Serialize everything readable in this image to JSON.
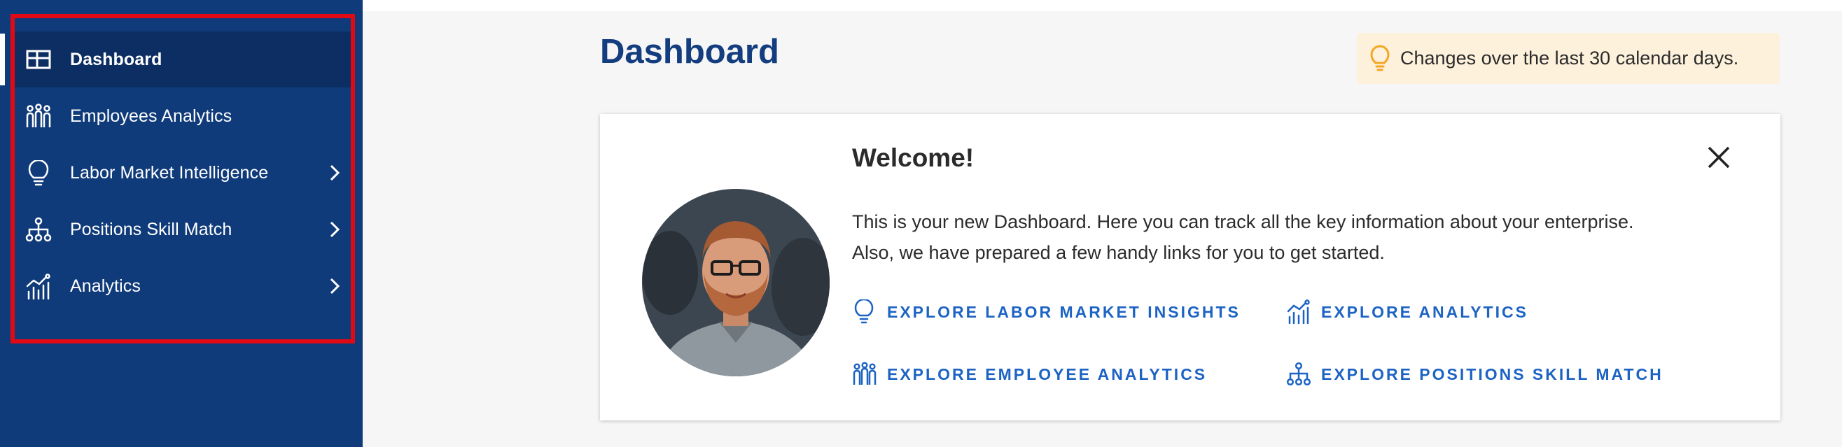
{
  "sidebar": {
    "items": [
      {
        "label": "Dashboard",
        "icon": "dashboard-grid-icon",
        "active": true
      },
      {
        "label": "Employees Analytics",
        "icon": "people-group-icon"
      },
      {
        "label": "Labor Market Intelligence",
        "icon": "lightbulb-icon",
        "has_submenu": true
      },
      {
        "label": "Positions Skill Match",
        "icon": "hierarchy-icon",
        "has_submenu": true
      },
      {
        "label": "Analytics",
        "icon": "trend-chart-icon",
        "has_submenu": true
      }
    ]
  },
  "main": {
    "title": "Dashboard",
    "notice": {
      "icon": "lightbulb-icon",
      "text": "Changes over the last 30 calendar days."
    },
    "welcome_card": {
      "title": "Welcome!",
      "line1": "This is your new Dashboard. Here you can track all the key information about your enterprise.",
      "line2": "Also, we have prepared a few handy links for you to get started.",
      "links": [
        {
          "label": "EXPLORE LABOR MARKET INSIGHTS",
          "icon": "lightbulb-icon"
        },
        {
          "label": "EXPLORE ANALYTICS",
          "icon": "trend-chart-icon"
        },
        {
          "label": "EXPLORE EMPLOYEE ANALYTICS",
          "icon": "people-group-icon"
        },
        {
          "label": "EXPLORE POSITIONS SKILL MATCH",
          "icon": "hierarchy-icon"
        }
      ]
    }
  },
  "colors": {
    "sidebar_bg": "#103b7a",
    "sidebar_active_bg": "#0c2e62",
    "title": "#133d7e",
    "link": "#1c63c4",
    "notice_bg": "#fdf1dc",
    "notice_icon": "#f5a623",
    "highlight": "#e10914"
  }
}
